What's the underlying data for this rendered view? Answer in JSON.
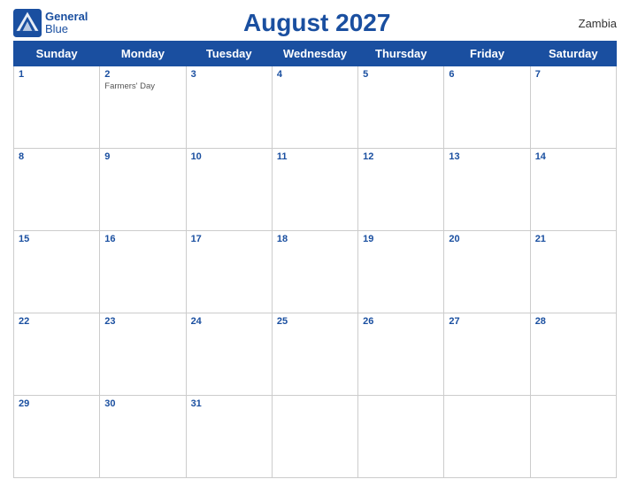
{
  "logo": {
    "line1": "General",
    "line2": "Blue"
  },
  "title": "August 2027",
  "country": "Zambia",
  "days_of_week": [
    "Sunday",
    "Monday",
    "Tuesday",
    "Wednesday",
    "Thursday",
    "Friday",
    "Saturday"
  ],
  "weeks": [
    [
      {
        "day": "1",
        "holiday": ""
      },
      {
        "day": "2",
        "holiday": "Farmers' Day"
      },
      {
        "day": "3",
        "holiday": ""
      },
      {
        "day": "4",
        "holiday": ""
      },
      {
        "day": "5",
        "holiday": ""
      },
      {
        "day": "6",
        "holiday": ""
      },
      {
        "day": "7",
        "holiday": ""
      }
    ],
    [
      {
        "day": "8",
        "holiday": ""
      },
      {
        "day": "9",
        "holiday": ""
      },
      {
        "day": "10",
        "holiday": ""
      },
      {
        "day": "11",
        "holiday": ""
      },
      {
        "day": "12",
        "holiday": ""
      },
      {
        "day": "13",
        "holiday": ""
      },
      {
        "day": "14",
        "holiday": ""
      }
    ],
    [
      {
        "day": "15",
        "holiday": ""
      },
      {
        "day": "16",
        "holiday": ""
      },
      {
        "day": "17",
        "holiday": ""
      },
      {
        "day": "18",
        "holiday": ""
      },
      {
        "day": "19",
        "holiday": ""
      },
      {
        "day": "20",
        "holiday": ""
      },
      {
        "day": "21",
        "holiday": ""
      }
    ],
    [
      {
        "day": "22",
        "holiday": ""
      },
      {
        "day": "23",
        "holiday": ""
      },
      {
        "day": "24",
        "holiday": ""
      },
      {
        "day": "25",
        "holiday": ""
      },
      {
        "day": "26",
        "holiday": ""
      },
      {
        "day": "27",
        "holiday": ""
      },
      {
        "day": "28",
        "holiday": ""
      }
    ],
    [
      {
        "day": "29",
        "holiday": ""
      },
      {
        "day": "30",
        "holiday": ""
      },
      {
        "day": "31",
        "holiday": ""
      },
      {
        "day": "",
        "holiday": ""
      },
      {
        "day": "",
        "holiday": ""
      },
      {
        "day": "",
        "holiday": ""
      },
      {
        "day": "",
        "holiday": ""
      }
    ]
  ],
  "colors": {
    "header_bg": "#1a4fa0",
    "header_text": "#ffffff",
    "title_color": "#1a4fa0",
    "day_number_color": "#1a4fa0"
  }
}
